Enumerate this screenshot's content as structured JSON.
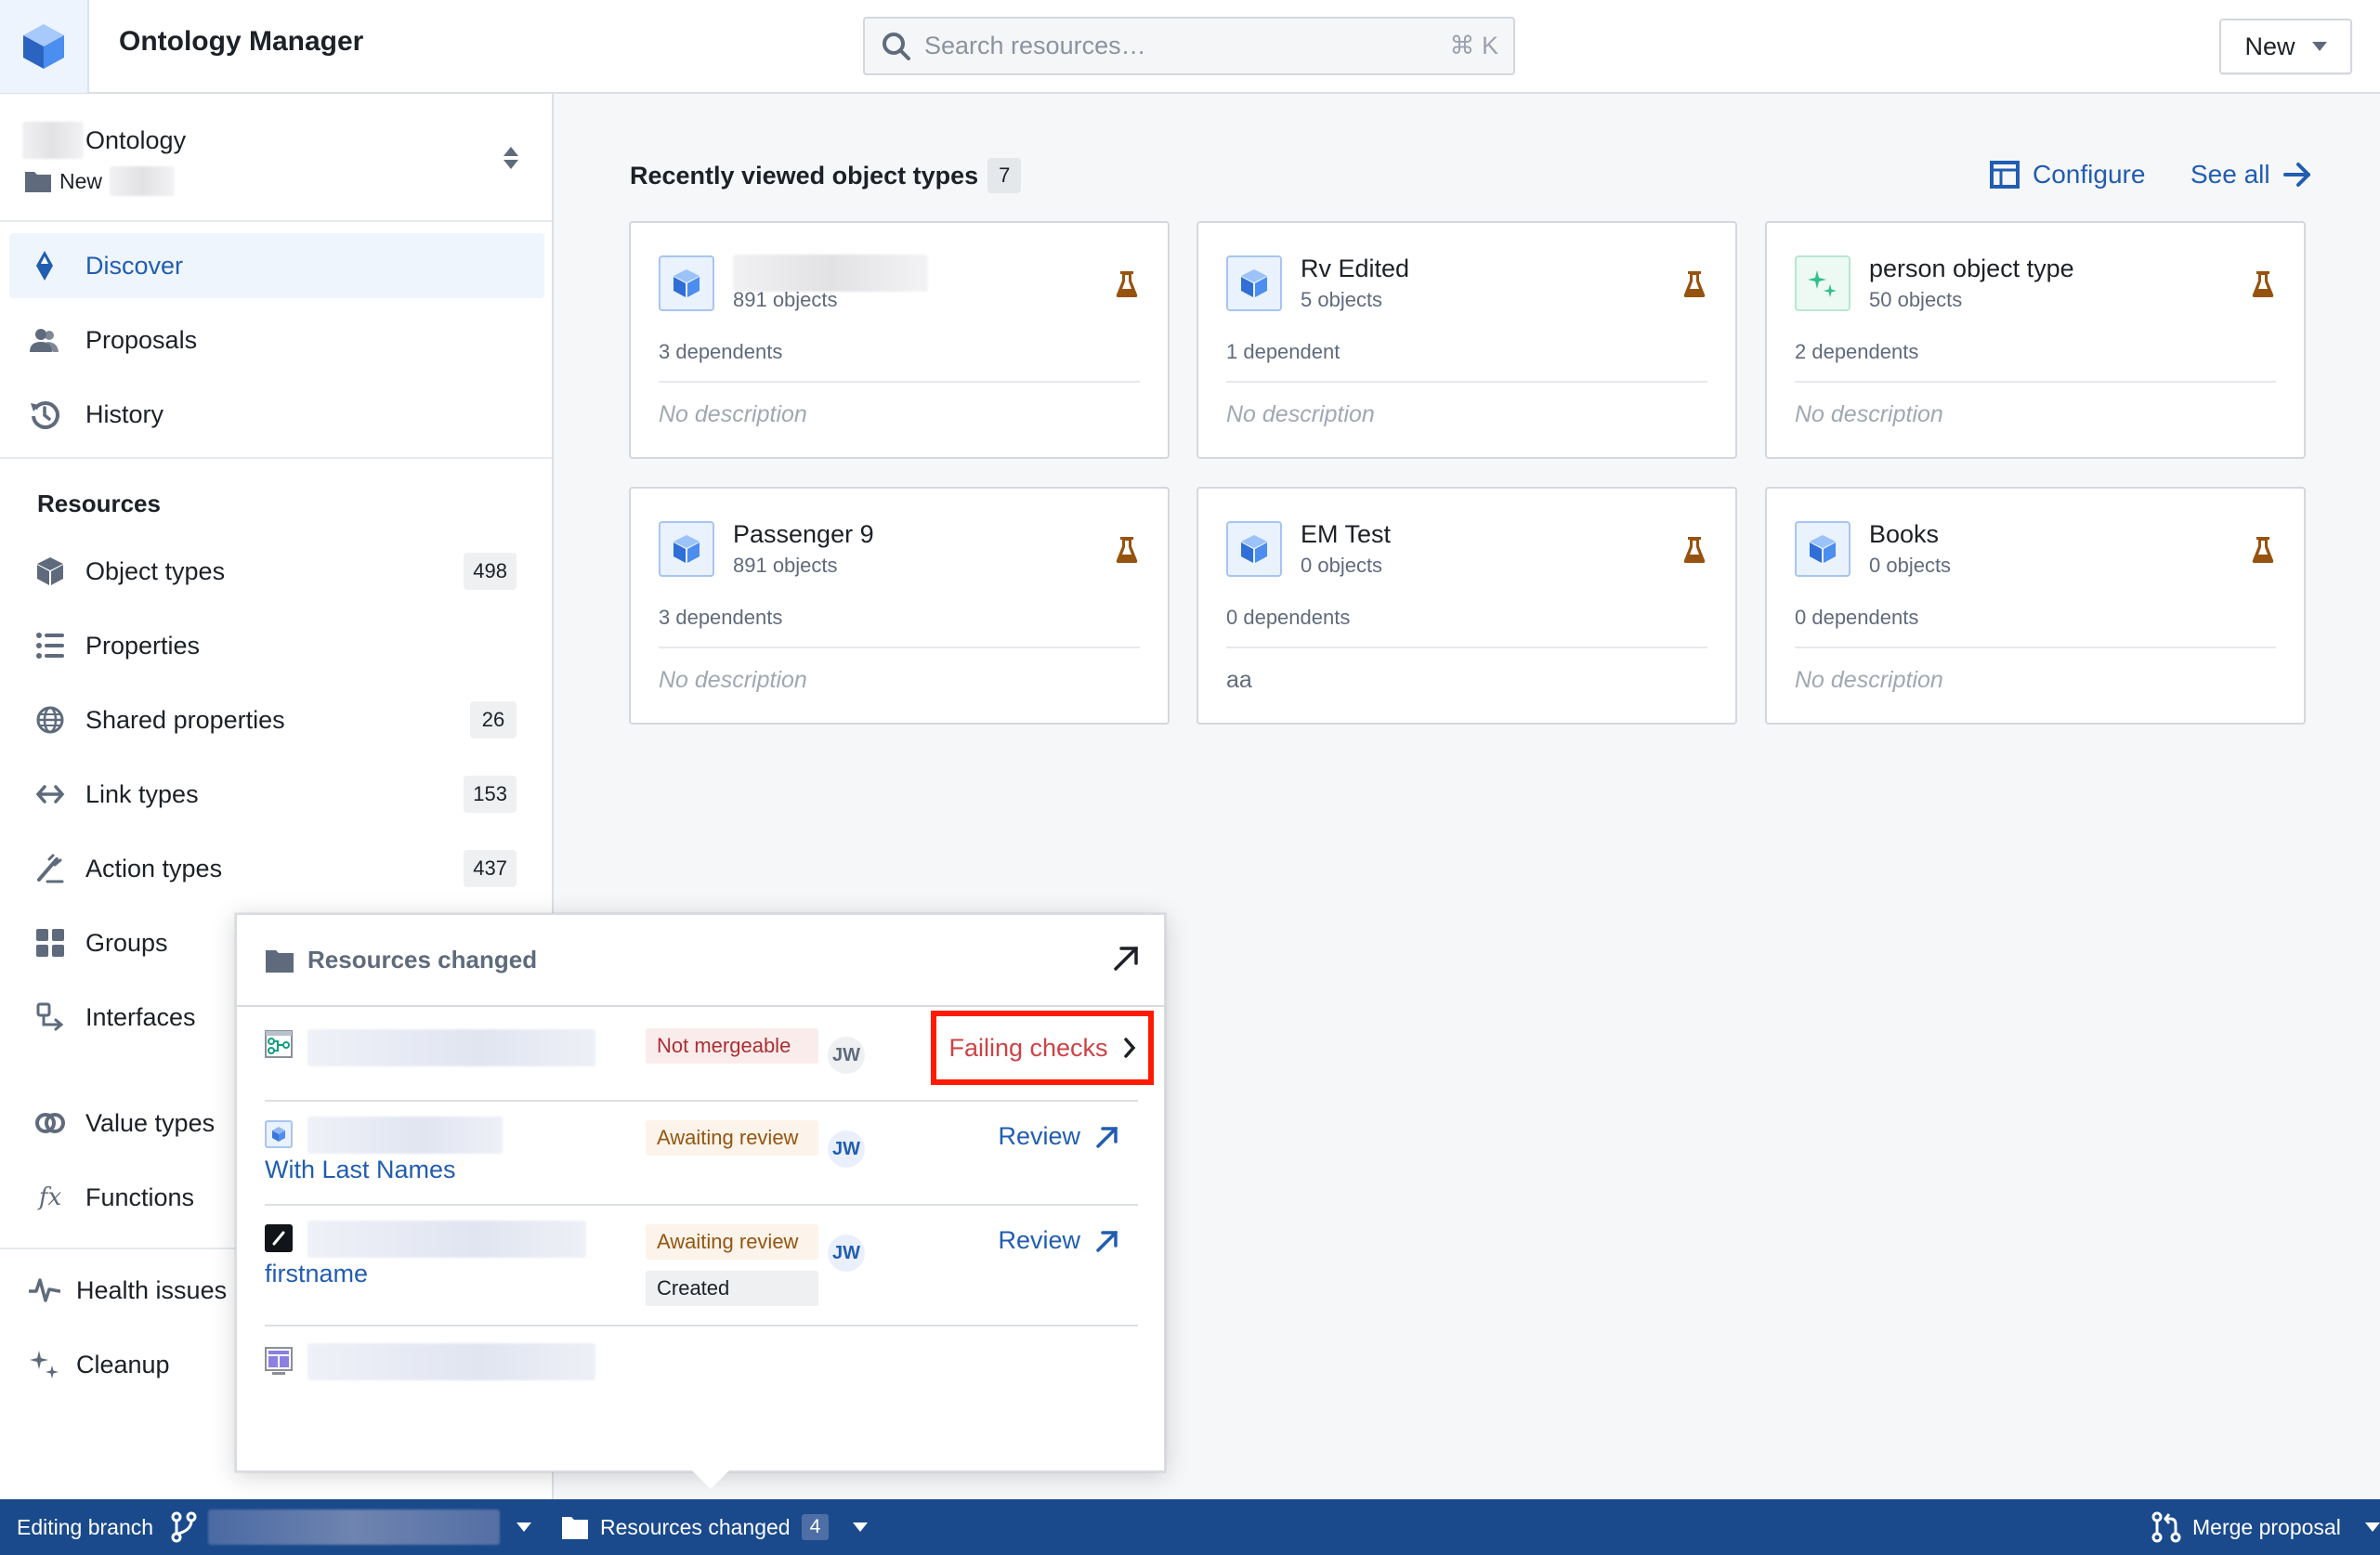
{
  "header": {
    "app_title": "Ontology Manager",
    "search_placeholder": "Search resources…",
    "search_shortcut": "⌘ K",
    "new_button": "New"
  },
  "sidebar": {
    "ontology_suffix": "Ontology",
    "folder_prefix": "New",
    "nav": [
      {
        "label": "Discover",
        "icon": "compass-icon",
        "active": true
      },
      {
        "label": "Proposals",
        "icon": "people-icon"
      },
      {
        "label": "History",
        "icon": "history-icon"
      }
    ],
    "resources_title": "Resources",
    "resources": [
      {
        "label": "Object types",
        "icon": "cube-icon",
        "count": "498"
      },
      {
        "label": "Properties",
        "icon": "list-icon",
        "count": null
      },
      {
        "label": "Shared properties",
        "icon": "globe-icon",
        "count": "26"
      },
      {
        "label": "Link types",
        "icon": "link-arrows-icon",
        "count": "153"
      },
      {
        "label": "Action types",
        "icon": "action-icon",
        "count": "437"
      },
      {
        "label": "Groups",
        "icon": "grid-icon",
        "count": null
      },
      {
        "label": "Interfaces",
        "icon": "interface-icon",
        "count": null
      },
      {
        "label": "Value types",
        "icon": "value-type-icon",
        "count": null
      },
      {
        "label": "Functions",
        "icon": "function-icon",
        "count": null
      }
    ],
    "bottom": [
      {
        "label": "Health issues",
        "icon": "pulse-icon"
      },
      {
        "label": "Cleanup",
        "icon": "sparkle-icon"
      }
    ]
  },
  "main": {
    "section_title": "Recently viewed object types",
    "section_count": "7",
    "configure_label": "Configure",
    "see_all_label": "See all",
    "cards": [
      {
        "title": "",
        "objects": "891 objects",
        "dependents": "3 dependents",
        "description": "No description",
        "icon": "cube",
        "title_redacted": true
      },
      {
        "title": "Rv Edited",
        "objects": "5 objects",
        "dependents": "1 dependent",
        "description": "No description",
        "icon": "cube"
      },
      {
        "title": "person object type",
        "objects": "50 objects",
        "dependents": "2 dependents",
        "description": "No description",
        "icon": "sparkle"
      },
      {
        "title": "Passenger 9",
        "objects": "891 objects",
        "dependents": "3 dependents",
        "description": "No description",
        "icon": "cube"
      },
      {
        "title": "EM Test",
        "objects": "0 objects",
        "dependents": "0 dependents",
        "description": "aa",
        "icon": "cube",
        "has_description": true
      },
      {
        "title": "Books",
        "objects": "0 objects",
        "dependents": "0 dependents",
        "description": "No description",
        "icon": "cube"
      }
    ]
  },
  "popover": {
    "title": "Resources changed",
    "rows": [
      {
        "icon": "pipeline-icon",
        "link": "",
        "tags": [
          {
            "label": "Not mergeable",
            "tone": "red"
          }
        ],
        "avatar": "JW",
        "action": "Failing checks",
        "action_type": "failing"
      },
      {
        "icon": "cube-icon",
        "link": "With Last Names",
        "tags": [
          {
            "label": "Awaiting review",
            "tone": "orange"
          }
        ],
        "avatar": "JW",
        "action": "Review",
        "action_type": "review"
      },
      {
        "icon": "pencil-icon",
        "link": "firstname",
        "tags": [
          {
            "label": "Awaiting review",
            "tone": "orange"
          },
          {
            "label": "Created",
            "tone": "gray"
          }
        ],
        "avatar": "JW",
        "action": "Review",
        "action_type": "review"
      },
      {
        "icon": "workshop-icon",
        "link": "",
        "tags": [],
        "avatar": null,
        "action": null
      }
    ]
  },
  "bottombar": {
    "editing_label": "Editing branch",
    "resources_changed_label": "Resources changed",
    "resources_changed_count": "4",
    "merge_label": "Merge proposal"
  },
  "colors": {
    "accent": "#215db0",
    "bottombar": "#1a4a8c",
    "flask": "#96530f",
    "danger": "#cd4246",
    "highlight_box": "#ff1a00"
  }
}
